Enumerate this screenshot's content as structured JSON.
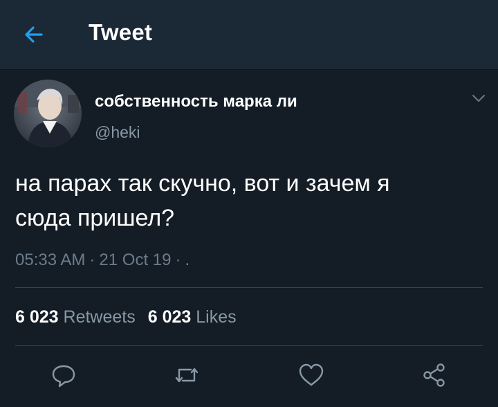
{
  "header": {
    "title": "Tweet",
    "back_icon": "arrow-left-icon"
  },
  "author": {
    "display_name": "собственность марка ли",
    "handle": "@heki",
    "avatar_icon": "avatar"
  },
  "tweet": {
    "text_line1": "на парах так скучно, вот и зачем я",
    "text_line2": "сюда пришел?",
    "time": "05:33 AM",
    "date": "21 Oct 19",
    "source": "."
  },
  "stats": {
    "retweets_count": "6 023",
    "retweets_label": "Retweets",
    "likes_count": "6 023",
    "likes_label": "Likes"
  },
  "actions": [
    "reply-icon",
    "retweet-icon",
    "like-icon",
    "share-icon"
  ],
  "colors": {
    "background": "#141d26",
    "header": "#1b2836",
    "accent": "#1da1f2",
    "muted": "#8899a6",
    "divider": "#38444d"
  }
}
